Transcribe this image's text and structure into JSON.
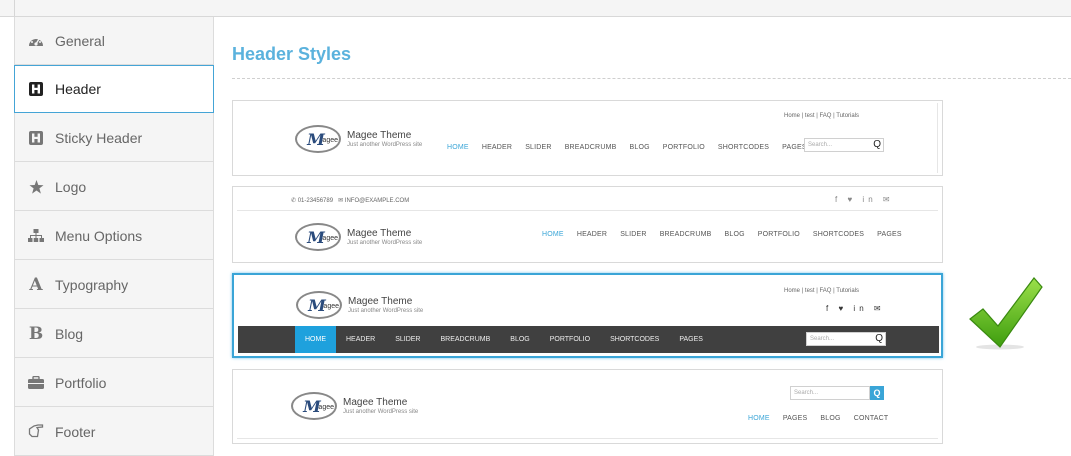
{
  "sidebar": {
    "items": [
      {
        "label": "General",
        "icon": "dashboard-icon"
      },
      {
        "label": "Header",
        "icon": "h-square-icon",
        "active": true
      },
      {
        "label": "Sticky Header",
        "icon": "h-square-icon"
      },
      {
        "label": "Logo",
        "icon": "star-icon"
      },
      {
        "label": "Menu Options",
        "icon": "sitemap-icon"
      },
      {
        "label": "Typography",
        "icon": "font-a-icon"
      },
      {
        "label": "Blog",
        "icon": "bold-b-icon"
      },
      {
        "label": "Portfolio",
        "icon": "briefcase-icon"
      },
      {
        "label": "Footer",
        "icon": "hand-pointer-icon"
      }
    ]
  },
  "main": {
    "title": "Header Styles",
    "logo": {
      "name": "Magee Theme",
      "tagline": "Just another WordPress site",
      "badge_m": "M",
      "badge_agee": "agee"
    },
    "search_placeholder": "Search...",
    "search_icon": "Q",
    "style1": {
      "toplinks": "Home  |  test  |  FAQ  |  Tutorials",
      "nav": [
        "HOME",
        "HEADER",
        "SLIDER",
        "BREADCRUMB",
        "BLOG",
        "PORTFOLIO",
        "SHORTCODES",
        "PAGES"
      ]
    },
    "style2": {
      "phone": "01-23456789",
      "email": "INFO@EXAMPLE.COM",
      "social": "f  ♥  in  ✉",
      "nav": [
        "HOME",
        "HEADER",
        "SLIDER",
        "BREADCRUMB",
        "BLOG",
        "PORTFOLIO",
        "SHORTCODES",
        "PAGES"
      ]
    },
    "style3": {
      "toplinks": "Home  |  test  |  FAQ  |  Tutorials",
      "social": "f  ♥  in  ✉",
      "nav": [
        "HOME",
        "HEADER",
        "SLIDER",
        "BREADCRUMB",
        "BLOG",
        "PORTFOLIO",
        "SHORTCODES",
        "PAGES"
      ]
    },
    "style4": {
      "nav": [
        "HOME",
        "PAGES",
        "BLOG",
        "CONTACT"
      ]
    },
    "selected_style": 3,
    "accent": "#3aa5d7",
    "check_color": "#5bbf1a"
  }
}
